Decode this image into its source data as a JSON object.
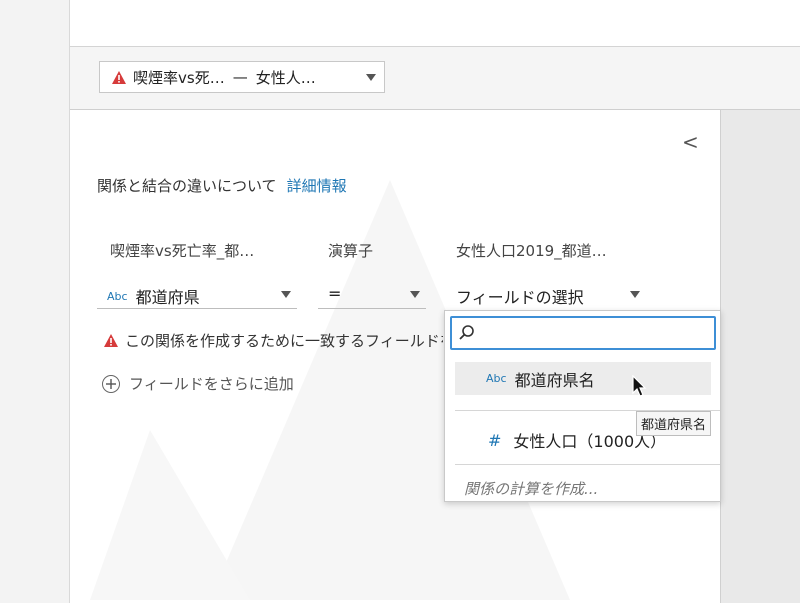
{
  "relationship_selector": {
    "left_table": "喫煙率vs死…",
    "separator": "—",
    "right_table": "女性人…"
  },
  "collapse_label": "<",
  "info": {
    "text": "関係と結合の違いについて",
    "link": "詳細情報"
  },
  "columns": {
    "left_header": "喫煙率vs死亡率_都…",
    "operator_header": "演算子",
    "right_header": "女性人口2019_都道…"
  },
  "left_field": {
    "type_label": "Abc",
    "value": "都道府県"
  },
  "operator_field": {
    "value": "="
  },
  "right_field": {
    "value": "フィールドの選択"
  },
  "warning_text": "この関係を作成するために一致するフィールドを選択してください",
  "add_field_label": "フィールドをさらに追加",
  "add_field_icon": "⊕",
  "dropdown": {
    "search_value": "",
    "options": [
      {
        "type_label": "Abc",
        "label": "都道府県名"
      },
      {
        "type_label": "#",
        "label": "女性人口（1000人）"
      }
    ],
    "create_calc": "関係の計算を作成..."
  },
  "tooltip": "都道府県名",
  "colors": {
    "accent": "#1f77b4",
    "warning": "#d63b3b",
    "focus": "#3e8fd6"
  }
}
